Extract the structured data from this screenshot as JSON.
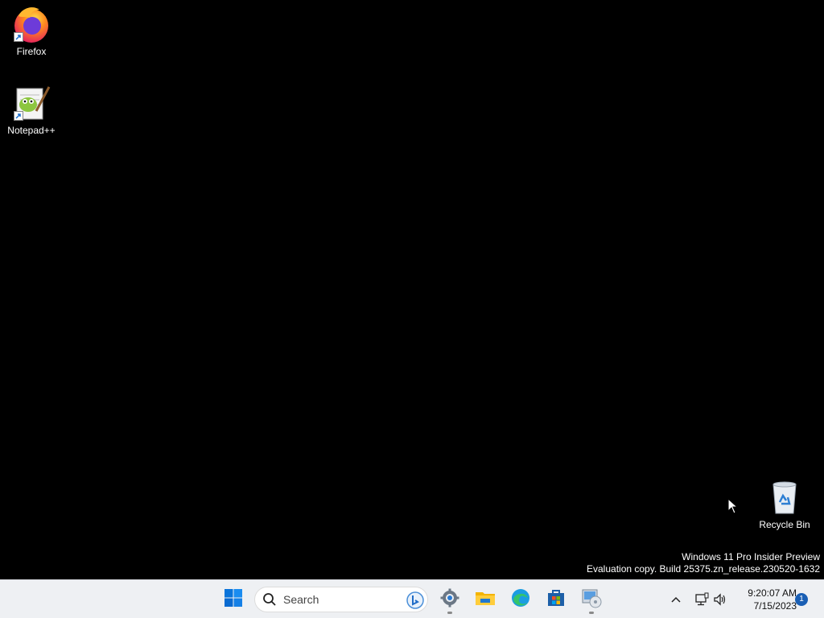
{
  "desktop": {
    "icons": [
      {
        "label": "Firefox",
        "icon": "firefox-icon"
      },
      {
        "label": "Notepad++",
        "icon": "notepadpp-icon"
      },
      {
        "label": "Recycle Bin",
        "icon": "recycle-bin-icon"
      }
    ],
    "watermark": {
      "line1": "Windows 11 Pro Insider Preview",
      "line2": "Evaluation copy. Build 25375.zn_release.230520-1632"
    }
  },
  "taskbar": {
    "start_icon": "windows-start-icon",
    "search": {
      "label": "Search",
      "icon": "search-icon",
      "bing_icon": "bing-icon"
    },
    "pinned": [
      {
        "icon": "settings-gear-icon",
        "running": true
      },
      {
        "icon": "file-explorer-icon",
        "running": false
      },
      {
        "icon": "edge-icon",
        "running": false
      },
      {
        "icon": "microsoft-store-icon",
        "running": false
      },
      {
        "icon": "disk-utility-icon",
        "running": true
      }
    ],
    "tray": {
      "chevron_icon": "chevron-up-icon",
      "network_icon": "network-icon",
      "volume_icon": "volume-icon",
      "time": "9:20:07 AM",
      "date": "7/15/2023",
      "notification_count": "1"
    }
  },
  "colors": {
    "desktop_bg": "#000000",
    "taskbar_bg": "#eef0f3",
    "accent": "#0067c0"
  }
}
